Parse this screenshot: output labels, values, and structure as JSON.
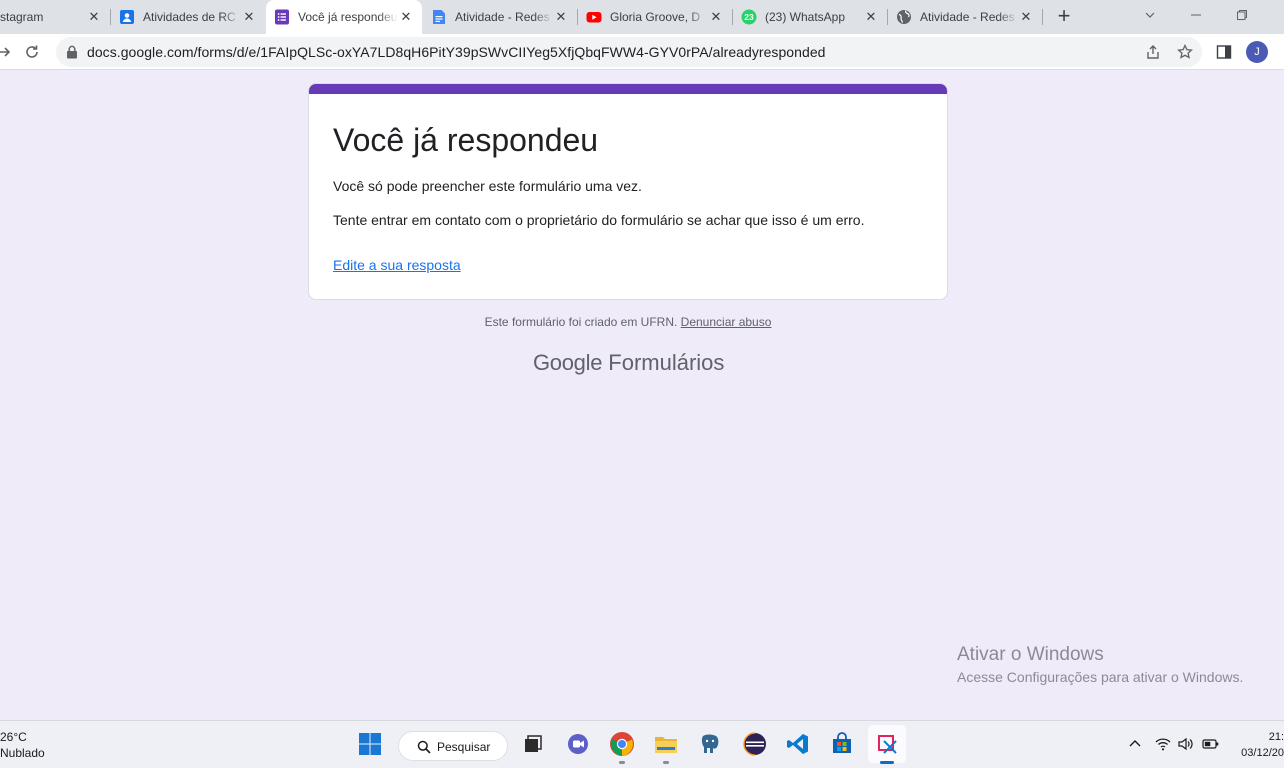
{
  "browser": {
    "tabs": [
      {
        "label": "stagram",
        "icon": "instagram-icon",
        "active": false
      },
      {
        "label": "Atividades de RC",
        "icon": "classroom-icon",
        "active": false
      },
      {
        "label": "Você já respondeu",
        "icon": "google-forms-icon",
        "active": true
      },
      {
        "label": "Atividade - Redes",
        "icon": "google-docs-icon",
        "active": false
      },
      {
        "label": "Gloria Groove, D",
        "icon": "youtube-icon",
        "active": false
      },
      {
        "label": "(23) WhatsApp",
        "icon": "whatsapp-icon",
        "active": false
      },
      {
        "label": "Atividade - Redes",
        "icon": "globe-icon",
        "active": false
      }
    ],
    "close_glyph": "✕",
    "new_tab_glyph": "+",
    "url": "docs.google.com/forms/d/e/1FAIpQLSc-oxYA7LD8qH6PitY39pSWvCIIYeg5XfjQbqFWW4-GYV0rPA/alreadyresponded",
    "profile_initial": "J",
    "whatsapp_badge": "23"
  },
  "form": {
    "title": "Você já respondeu",
    "message1": "Você só pode preencher este formulário uma vez.",
    "message2": "Tente entrar em contato com o proprietário do formulário se achar que isso é um erro.",
    "edit_link": "Edite a sua resposta",
    "accent_color": "#673ab7"
  },
  "footer": {
    "created_text": "Este formulário foi criado em UFRN.",
    "abuse_link": "Denunciar abuso",
    "brand_google": "Google",
    "brand_product": "Formulários"
  },
  "watermark": {
    "line1": "Ativar o Windows",
    "line2": "Acesse Configurações para ativar o Windows."
  },
  "taskbar": {
    "weather_temp": "26°C",
    "weather_desc": "Nublado",
    "search_label": "Pesquisar",
    "time": "21:",
    "date": "03/12/20"
  }
}
